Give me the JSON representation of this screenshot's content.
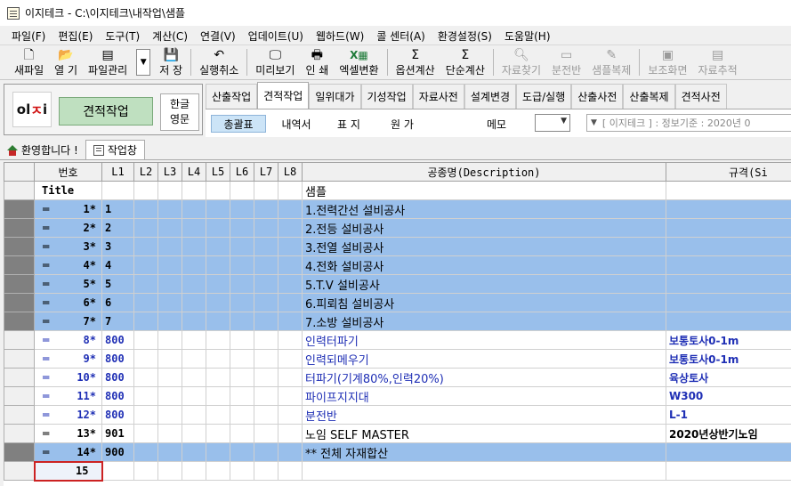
{
  "window": {
    "title": "이지테크 - C:\\이지테크\\내작업\\샘플"
  },
  "menu": [
    "파일(F)",
    "편집(E)",
    "도구(T)",
    "계산(C)",
    "연결(V)",
    "업데이트(U)",
    "웹하드(W)",
    "콜 센터(A)",
    "환경설정(S)",
    "도움말(H)"
  ],
  "toolbar": {
    "new_file": "새파일",
    "open": "열 기",
    "file_mgmt": "파일관리",
    "save": "저 장",
    "undo": "실행취소",
    "preview": "미리보기",
    "print": "인 쇄",
    "excel": "엑셀변환",
    "option_calc": "옵션계산",
    "simple_calc": "단순계산",
    "find_data": "자료찾기",
    "distribution_panel": "분전반",
    "sample_copy": "샘플복제",
    "aux_screen": "보조화면",
    "data_extract": "자료추적"
  },
  "logo": {
    "text_black": "ol",
    "text_red": "ㅈ",
    "text_black2": "i"
  },
  "mode_button": "견적작업",
  "lang": {
    "korean": "한글",
    "english": "영문"
  },
  "tabs": [
    "산출작업",
    "견적작업",
    "일위대가",
    "기성작업",
    "자료사전",
    "설계변경",
    "도급/실행",
    "산출사전",
    "산출복제",
    "견적사전"
  ],
  "subtabs": [
    "총괄표",
    "내역서",
    "표 지",
    "원 가"
  ],
  "memo": {
    "label": "메모",
    "value": ""
  },
  "info_text": "[ 이지테크 ] : 정보기준 : 2020년 0",
  "window_tabs": {
    "welcome": "환영합니다 !",
    "worksheet": "작업창"
  },
  "grid": {
    "headers": {
      "num": "번호",
      "l1": "L1",
      "l2": "L2",
      "l3": "L3",
      "l4": "L4",
      "l5": "L5",
      "l6": "L6",
      "l7": "L7",
      "l8": "L8",
      "description": "공종명(Description)",
      "spec": "규격(Si"
    },
    "title_row": {
      "label": "Title",
      "description": "샘플"
    },
    "rows": [
      {
        "num": "1*",
        "l1": "1",
        "description": "1.전력간선 설비공사",
        "spec": ""
      },
      {
        "num": "2*",
        "l1": "2",
        "description": "2.전등 설비공사",
        "spec": ""
      },
      {
        "num": "3*",
        "l1": "3",
        "description": "3.전열 설비공사",
        "spec": ""
      },
      {
        "num": "4*",
        "l1": "4",
        "description": "4.전화 설비공사",
        "spec": ""
      },
      {
        "num": "5*",
        "l1": "5",
        "description": "5.T.V 설비공사",
        "spec": ""
      },
      {
        "num": "6*",
        "l1": "6",
        "description": "6.피뢰침 설비공사",
        "spec": ""
      },
      {
        "num": "7*",
        "l1": "7",
        "description": "7.소방 설비공사",
        "spec": ""
      },
      {
        "num": "8*",
        "l1": "800",
        "description": "인력터파기",
        "spec": "보통토사0-1m"
      },
      {
        "num": "9*",
        "l1": "800",
        "description": "인력되메우기",
        "spec": "보통토사0-1m"
      },
      {
        "num": "10*",
        "l1": "800",
        "description": "터파기(기계80%,인력20%)",
        "spec": "육상토사"
      },
      {
        "num": "11*",
        "l1": "800",
        "description": "파이프지지대",
        "spec": "W300"
      },
      {
        "num": "12*",
        "l1": "800",
        "description": "분전반",
        "spec": "L-1"
      },
      {
        "num": "13*",
        "l1": "901",
        "description": "노임 SELF MASTER",
        "spec": "2020년상반기노임"
      },
      {
        "num": "14*",
        "l1": "900",
        "description": "** 전체 자재합산",
        "spec": ""
      }
    ],
    "new_row": "15"
  }
}
